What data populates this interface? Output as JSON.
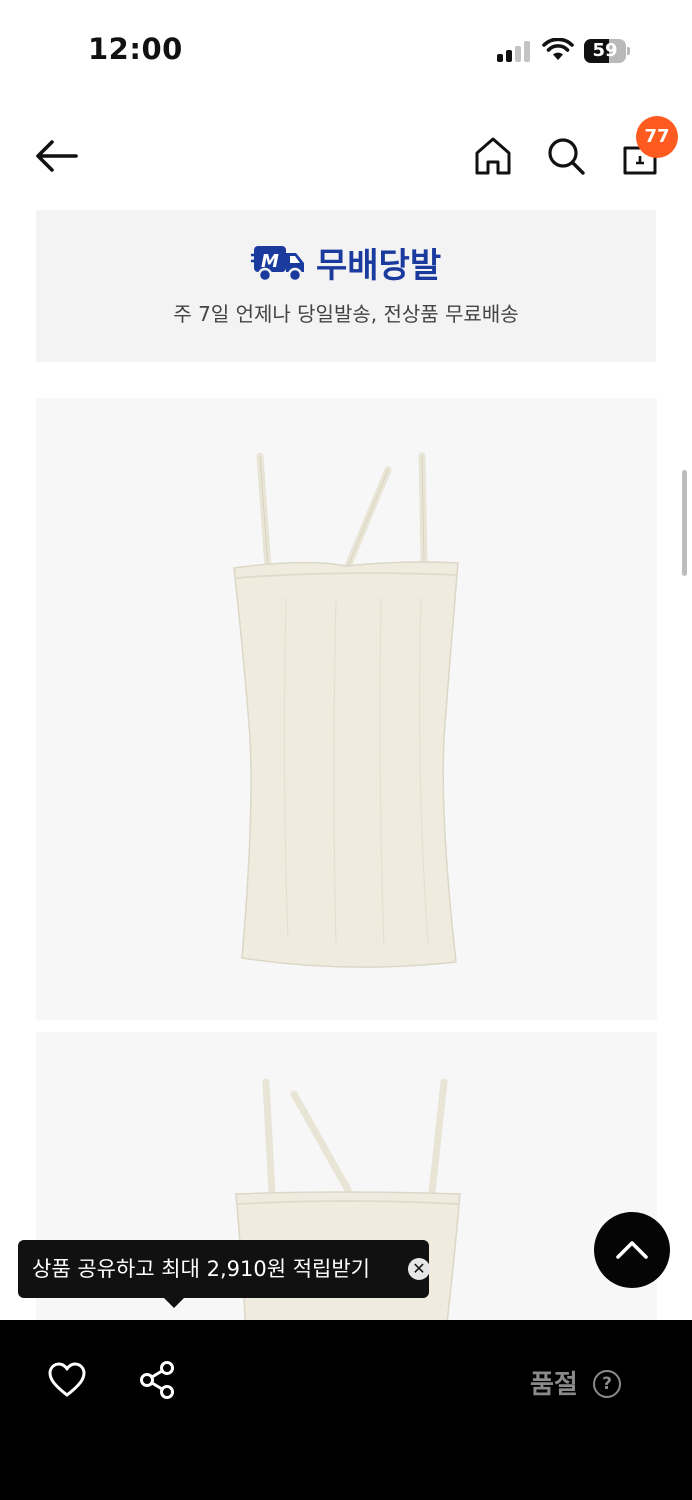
{
  "status_bar": {
    "time": "12:00",
    "battery_level": "59",
    "signal_icon": "cellular-signal-icon",
    "wifi_icon": "wifi-icon"
  },
  "header": {
    "back_icon": "arrow-left-icon",
    "home_icon": "home-icon",
    "search_icon": "search-icon",
    "cart_icon": "shopping-bag-icon",
    "cart_count": "77",
    "badge_color": "#ff5a1f"
  },
  "banner": {
    "logo_icon": "delivery-truck-icon",
    "title": "무배당발",
    "subtitle": "주 7일 언제나 당일발송, 전상품 무료배송",
    "brand_color": "#1a3a9e"
  },
  "tooltip": {
    "text": "상품 공유하고 최대 2,910원 적립받기",
    "close_icon": "close-icon"
  },
  "scroll_top": {
    "icon": "chevron-up-icon"
  },
  "bottom_bar": {
    "like_icon": "heart-icon",
    "share_icon": "share-icon",
    "status_label": "품절",
    "help_icon": "question-circle-icon"
  }
}
